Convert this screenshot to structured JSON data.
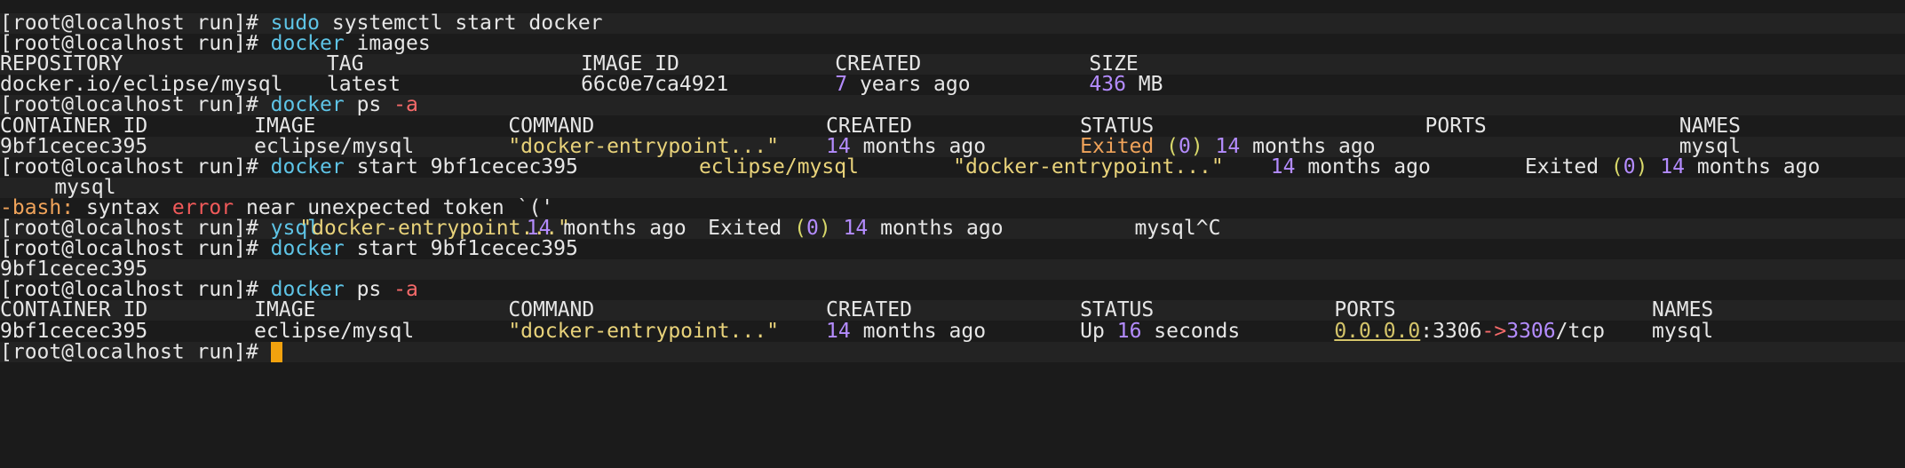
{
  "terminal": {
    "top_partial": "",
    "lines": [
      {
        "segs": [
          {
            "t": "[root@localhost run]# ",
            "c": "fg-prompt"
          },
          {
            "t": "sudo",
            "c": "fg-cmd"
          },
          {
            "t": " systemctl start docker",
            "c": "fg-prompt"
          }
        ]
      },
      {
        "segs": [
          {
            "t": "[root@localhost run]# ",
            "c": "fg-prompt"
          },
          {
            "t": "docker",
            "c": "fg-cmd"
          },
          {
            "t": " images",
            "c": "fg-prompt"
          }
        ]
      },
      {
        "cols": [
          {
            "col": 0,
            "segs": [
              {
                "t": "REPOSITORY"
              }
            ]
          },
          {
            "col": 36,
            "segs": [
              {
                "t": "TAG"
              }
            ]
          },
          {
            "col": 64,
            "segs": [
              {
                "t": "IMAGE ID"
              }
            ]
          },
          {
            "col": 92,
            "segs": [
              {
                "t": "CREATED"
              }
            ]
          },
          {
            "col": 120,
            "segs": [
              {
                "t": "SIZE"
              }
            ]
          }
        ]
      },
      {
        "cols": [
          {
            "col": 0,
            "segs": [
              {
                "t": "docker.io/eclipse/mysql"
              }
            ]
          },
          {
            "col": 36,
            "segs": [
              {
                "t": "latest"
              }
            ]
          },
          {
            "col": 64,
            "segs": [
              {
                "t": "66c0e7ca4921"
              }
            ]
          },
          {
            "col": 92,
            "segs": [
              {
                "t": "7",
                "c": "fg-num"
              },
              {
                "t": " years ago"
              }
            ]
          },
          {
            "col": 120,
            "segs": [
              {
                "t": "436",
                "c": "fg-num"
              },
              {
                "t": " MB"
              }
            ]
          }
        ]
      },
      {
        "segs": [
          {
            "t": "[root@localhost run]# ",
            "c": "fg-prompt"
          },
          {
            "t": "docker",
            "c": "fg-cmd"
          },
          {
            "t": " ps "
          },
          {
            "t": "-a",
            "c": "fg-flag"
          }
        ]
      },
      {
        "cols": [
          {
            "col": 0,
            "segs": [
              {
                "t": "CONTAINER ID"
              }
            ]
          },
          {
            "col": 28,
            "segs": [
              {
                "t": "IMAGE"
              }
            ]
          },
          {
            "col": 56,
            "segs": [
              {
                "t": "COMMAND"
              }
            ]
          },
          {
            "col": 91,
            "segs": [
              {
                "t": "CREATED"
              }
            ]
          },
          {
            "col": 119,
            "segs": [
              {
                "t": "STATUS"
              }
            ]
          },
          {
            "col": 157,
            "segs": [
              {
                "t": "PORTS"
              }
            ]
          },
          {
            "col": 185,
            "segs": [
              {
                "t": "NAMES"
              }
            ]
          }
        ]
      },
      {
        "cols": [
          {
            "col": 0,
            "segs": [
              {
                "t": "9bf1cecec395"
              }
            ]
          },
          {
            "col": 28,
            "segs": [
              {
                "t": "eclipse/mysql"
              }
            ]
          },
          {
            "col": 56,
            "segs": [
              {
                "t": "\"docker-entrypoint...\"",
                "c": "fg-str"
              }
            ]
          },
          {
            "col": 91,
            "segs": [
              {
                "t": "14",
                "c": "fg-num"
              },
              {
                "t": " months ago"
              }
            ]
          },
          {
            "col": 119,
            "segs": [
              {
                "t": "Exited ",
                "c": "fg-orange"
              },
              {
                "t": "(",
                "c": "fg-paren"
              },
              {
                "t": "0",
                "c": "fg-num"
              },
              {
                "t": ")",
                "c": "fg-paren"
              },
              {
                "t": " "
              },
              {
                "t": "14",
                "c": "fg-num"
              },
              {
                "t": " months ago"
              }
            ]
          },
          {
            "col": 185,
            "segs": [
              {
                "t": "mysql"
              }
            ]
          }
        ]
      },
      {
        "cols": [
          {
            "col": 0,
            "segs": [
              {
                "t": "[root@localhost run]# "
              },
              {
                "t": "docker",
                "c": "fg-cmd"
              },
              {
                "t": " start 9bf1cecec395"
              }
            ]
          },
          {
            "col": 77,
            "segs": [
              {
                "t": "eclipse/mysql",
                "c": "fg-str"
              }
            ]
          },
          {
            "col": 105,
            "segs": [
              {
                "t": "\"docker-entrypoint...\"",
                "c": "fg-str"
              }
            ]
          },
          {
            "col": 140,
            "segs": [
              {
                "t": "14",
                "c": "fg-num"
              },
              {
                "t": " months ago"
              }
            ]
          },
          {
            "col": 168,
            "segs": [
              {
                "t": "Exited "
              },
              {
                "t": "(",
                "c": "fg-paren"
              },
              {
                "t": "0",
                "c": "fg-num"
              },
              {
                "t": ")",
                "c": "fg-paren"
              },
              {
                "t": " "
              },
              {
                "t": "14",
                "c": "fg-num"
              },
              {
                "t": " months ago"
              }
            ]
          }
        ]
      },
      {
        "cols": [
          {
            "col": 6,
            "segs": [
              {
                "t": "mysql"
              }
            ]
          }
        ]
      },
      {
        "segs": [
          {
            "t": "-bash:",
            "c": "fg-orange"
          },
          {
            "t": " syntax "
          },
          {
            "t": "error",
            "c": "fg-red"
          },
          {
            "t": " near unexpected token `('"
          }
        ]
      },
      {
        "cols": [
          {
            "col": 0,
            "segs": [
              {
                "t": "[root@localhost run]# "
              },
              {
                "t": "ysql",
                "c": "fg-cmd"
              }
            ]
          },
          {
            "col": 33,
            "segs": [
              {
                "t": "\"docker-entrypoint...\"",
                "c": "fg-str"
              }
            ]
          },
          {
            "col": 58,
            "segs": [
              {
                "t": "14",
                "c": "fg-num"
              },
              {
                "t": " months ago"
              }
            ]
          },
          {
            "col": 78,
            "segs": [
              {
                "t": "Exited "
              },
              {
                "t": "(",
                "c": "fg-paren"
              },
              {
                "t": "0",
                "c": "fg-num"
              },
              {
                "t": ")",
                "c": "fg-paren"
              },
              {
                "t": " "
              },
              {
                "t": "14",
                "c": "fg-num"
              },
              {
                "t": " months ago"
              }
            ]
          },
          {
            "col": 125,
            "segs": [
              {
                "t": "mysql^C"
              }
            ]
          }
        ]
      },
      {
        "segs": [
          {
            "t": "[root@localhost run]# "
          },
          {
            "t": "docker",
            "c": "fg-cmd"
          },
          {
            "t": " start 9bf1cecec395"
          }
        ]
      },
      {
        "segs": [
          {
            "t": "9bf1cecec395"
          }
        ]
      },
      {
        "segs": [
          {
            "t": "[root@localhost run]# "
          },
          {
            "t": "docker",
            "c": "fg-cmd"
          },
          {
            "t": " ps "
          },
          {
            "t": "-a",
            "c": "fg-flag"
          }
        ]
      },
      {
        "cols": [
          {
            "col": 0,
            "segs": [
              {
                "t": "CONTAINER ID"
              }
            ]
          },
          {
            "col": 28,
            "segs": [
              {
                "t": "IMAGE"
              }
            ]
          },
          {
            "col": 56,
            "segs": [
              {
                "t": "COMMAND"
              }
            ]
          },
          {
            "col": 91,
            "segs": [
              {
                "t": "CREATED"
              }
            ]
          },
          {
            "col": 119,
            "segs": [
              {
                "t": "STATUS"
              }
            ]
          },
          {
            "col": 147,
            "segs": [
              {
                "t": "PORTS"
              }
            ]
          },
          {
            "col": 182,
            "segs": [
              {
                "t": "NAMES"
              }
            ]
          }
        ]
      },
      {
        "cols": [
          {
            "col": 0,
            "segs": [
              {
                "t": "9bf1cecec395"
              }
            ]
          },
          {
            "col": 28,
            "segs": [
              {
                "t": "eclipse/mysql"
              }
            ]
          },
          {
            "col": 56,
            "segs": [
              {
                "t": "\"docker-entrypoint...\"",
                "c": "fg-str"
              }
            ]
          },
          {
            "col": 91,
            "segs": [
              {
                "t": "14",
                "c": "fg-num"
              },
              {
                "t": " months ago"
              }
            ]
          },
          {
            "col": 119,
            "segs": [
              {
                "t": "Up "
              },
              {
                "t": "16",
                "c": "fg-num"
              },
              {
                "t": " seconds"
              }
            ]
          },
          {
            "col": 147,
            "segs": [
              {
                "t": "0.0.0.0",
                "c": "fg-ul"
              },
              {
                "t": ":3306"
              },
              {
                "t": "->",
                "c": "fg-flag"
              },
              {
                "t": "3306",
                "c": "fg-num"
              },
              {
                "t": "/tcp"
              }
            ]
          },
          {
            "col": 182,
            "segs": [
              {
                "t": "mysql"
              }
            ]
          }
        ]
      },
      {
        "segs": [
          {
            "t": "[root@localhost run]# "
          }
        ],
        "cursor": true
      }
    ]
  },
  "colors": {
    "background": "#1b1b1b",
    "alt_row": "#232323",
    "command": "#5ec4e6",
    "flag": "#f56a6a",
    "number": "#b48cff",
    "string": "#e8d27a",
    "cursor": "#f2a20e"
  }
}
